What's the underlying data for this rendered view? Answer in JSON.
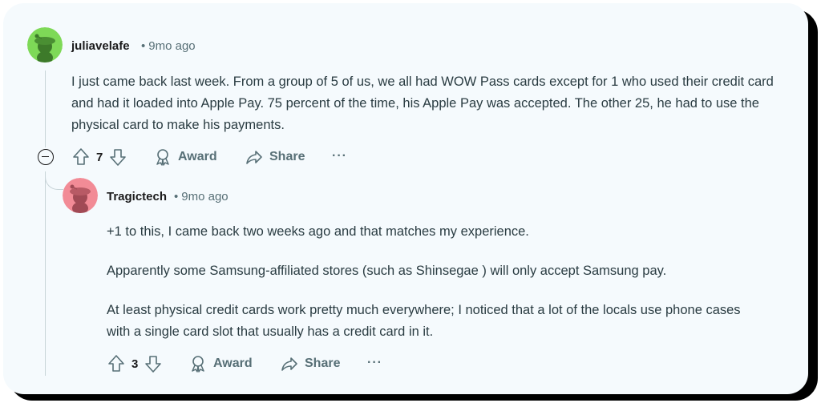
{
  "comments": [
    {
      "username": "juliavelafe",
      "separator": "•",
      "time": "9mo ago",
      "avatar_color": "#7ed957",
      "body": [
        "I just came back last week. From a group of 5 of us, we all had WOW Pass cards except for 1 who used their credit card and had it loaded into Apple Pay. 75 percent of the time, his Apple Pay was accepted. The other 25, he had to use the physical card to make his payments."
      ],
      "votes": "7",
      "award_label": "Award",
      "share_label": "Share",
      "more_label": "···"
    },
    {
      "username": "Tragictech",
      "separator": "•",
      "time": "9mo ago",
      "avatar_color": "#f28b96",
      "body": [
        "+1 to this, I came back two weeks ago and that matches my experience.",
        "Apparently some Samsung-affiliated stores (such as Shinsegae ) will only accept Samsung pay.",
        "At least physical credit cards work pretty much everywhere; I noticed that a lot of the locals use phone cases with a single card slot that usually has a credit card in it."
      ],
      "votes": "3",
      "award_label": "Award",
      "share_label": "Share",
      "more_label": "···"
    }
  ]
}
